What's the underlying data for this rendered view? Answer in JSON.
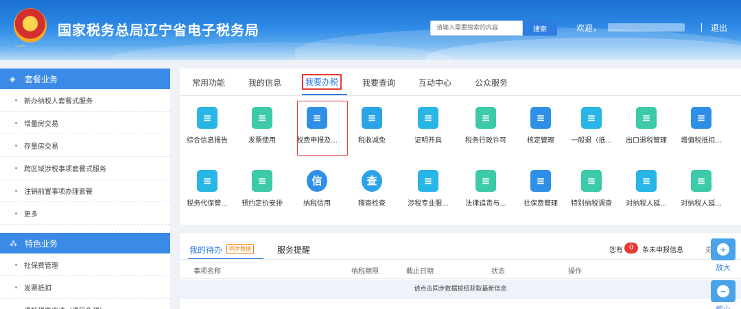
{
  "header": {
    "title": "国家税务总局辽宁省电子税务局",
    "search_placeholder": "请输入需要搜索的内容",
    "search_button": "搜索",
    "welcome": "欢迎，",
    "logout": "退出"
  },
  "sidebar": {
    "group1": {
      "title": "套餐业务",
      "items": [
        "新办纳税人套餐式服务",
        "增量房交易",
        "存量房交易",
        "跨区域涉税事项套餐式服务",
        "注销前置事项办理套餐",
        "更多"
      ]
    },
    "group2": {
      "title": "特色业务",
      "items": [
        "社保费管理",
        "发票抵扣",
        "退抵税费申请（退役免税）"
      ]
    }
  },
  "tabs": [
    "常用功能",
    "我的信息",
    "我要办税",
    "我要查询",
    "互动中心",
    "公众服务"
  ],
  "services_row1": [
    {
      "label": "综合信息报告",
      "icon": "info-report-icon",
      "color": "#29b6e6"
    },
    {
      "label": "发票使用",
      "icon": "invoice-icon",
      "color": "#3ccaa8"
    },
    {
      "label": "税费申报及...",
      "icon": "tax-declare-icon",
      "color": "#2f8fe6"
    },
    {
      "label": "税收减免",
      "icon": "tax-relief-icon",
      "color": "#2aa3e8"
    },
    {
      "label": "证明开具",
      "icon": "certificate-icon",
      "color": "#29b6e6"
    },
    {
      "label": "税务行政许可",
      "icon": "license-icon",
      "color": "#3ccaa8"
    },
    {
      "label": "核定管理",
      "icon": "verify-icon",
      "color": "#2f8fe6"
    },
    {
      "label": "一般退（抵...",
      "icon": "refund-icon",
      "color": "#29b6e6"
    },
    {
      "label": "出口退税管理",
      "icon": "export-refund-icon",
      "color": "#3ccaa8"
    },
    {
      "label": "增值税抵扣...",
      "icon": "vat-deduct-icon",
      "color": "#2f8fe6"
    }
  ],
  "services_row2": [
    {
      "label": "税务代保管...",
      "icon": "custody-icon",
      "color": "#29b6e6"
    },
    {
      "label": "预约定价安排",
      "icon": "pricing-icon",
      "color": "#3ccaa8"
    },
    {
      "label": "纳税信用",
      "icon": "credit-icon",
      "color": "#2f8fe6",
      "glyph": "信"
    },
    {
      "label": "稽查检查",
      "icon": "inspect-icon",
      "color": "#2aa3e8",
      "glyph": "查"
    },
    {
      "label": "涉税专业服...",
      "icon": "professional-icon",
      "color": "#29b6e6"
    },
    {
      "label": "法律追责与...",
      "icon": "law-icon",
      "color": "#3ccaa8"
    },
    {
      "label": "社保费管理",
      "icon": "social-security-icon",
      "color": "#2f8fe6"
    },
    {
      "label": "特别纳税调查",
      "icon": "special-tax-icon",
      "color": "#3ccaa8"
    },
    {
      "label": "对纳税人延...",
      "icon": "extension-icon",
      "color": "#29b6e6"
    },
    {
      "label": "对纳税人延...",
      "icon": "extension2-icon",
      "color": "#3ccaa8"
    }
  ],
  "todo": {
    "tab_pending": "我的待办",
    "sync_badge": "同步数据",
    "tab_reminder": "服务提醒",
    "notice_prefix": "您有",
    "unread_count": "0",
    "notice_suffix": "条未申报信息",
    "more": "更",
    "headers": [
      "事项名称",
      "纳税期限",
      "截止日期",
      "状态",
      "操作"
    ],
    "message": "请点击同步数据按钮获取最新信息"
  },
  "zoom": {
    "zoom_in": "放大",
    "zoom_out": "缩小"
  }
}
